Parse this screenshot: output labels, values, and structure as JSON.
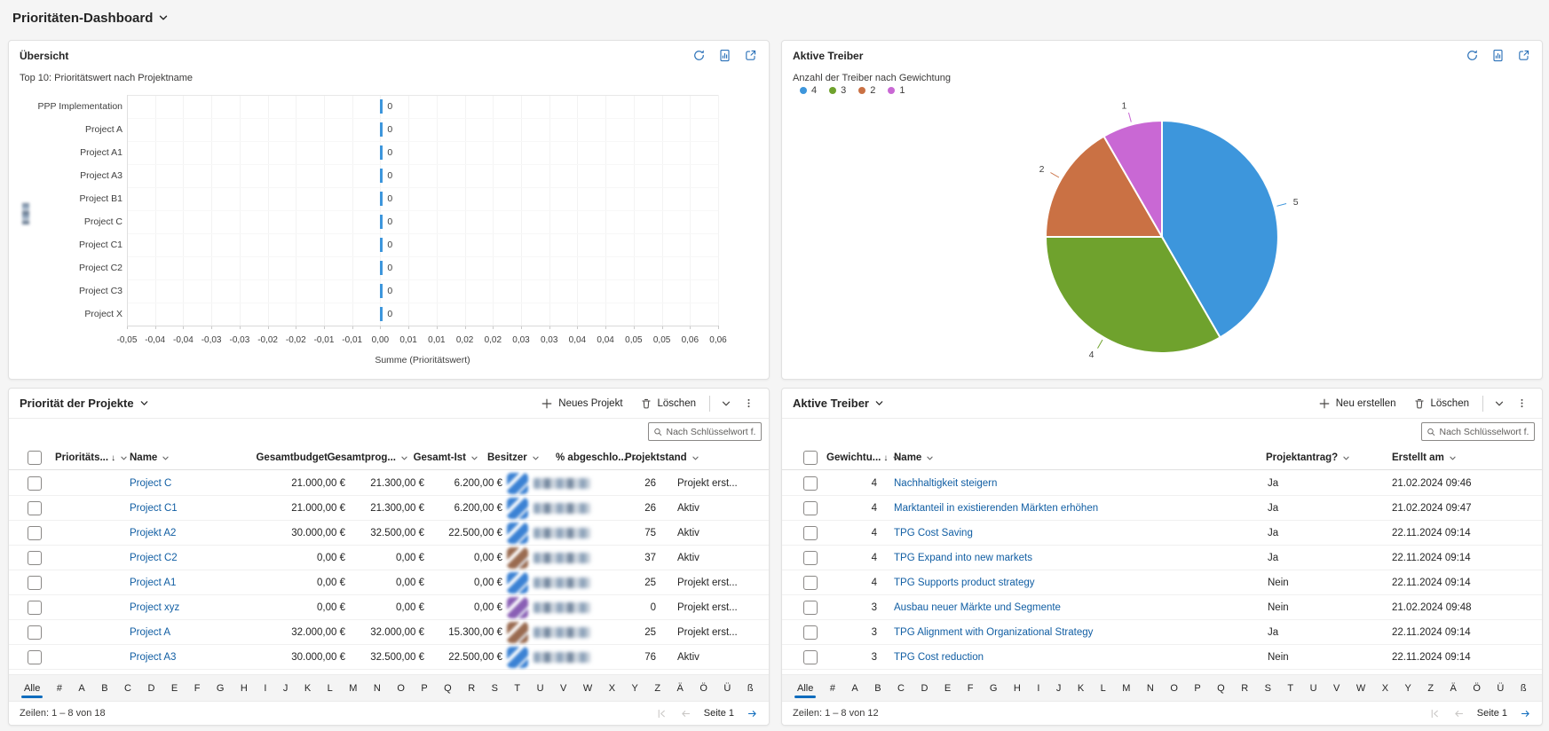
{
  "page": {
    "title": "Prioritäten-Dashboard"
  },
  "colors": {
    "accent": "#0F6CBD",
    "link": "#115EA3",
    "command_icon": "#484644",
    "chart_icon_blue": "#2B71B8",
    "bar_tick_blue": "#3D96DC",
    "pie_blue": "#3D96DC",
    "pie_green": "#6FA22D",
    "pie_orange": "#CA7144",
    "pie_magenta": "#C968D4",
    "pager_disabled": "#c8c6c4"
  },
  "overview_card": {
    "title": "Übersicht",
    "icons": [
      "refresh-icon",
      "report-icon",
      "popout-icon"
    ]
  },
  "drivers_chart_card": {
    "title": "Aktive Treiber",
    "icons": [
      "refresh-icon",
      "report-icon",
      "popout-icon"
    ]
  },
  "chart_data": [
    {
      "type": "bar",
      "orientation": "horizontal",
      "title": "Top 10: Prioritätswert nach Projektname",
      "categories": [
        "PPP Implementation",
        "Project A",
        "Project A1",
        "Project A3",
        "Project B1",
        "Project C",
        "Project C1",
        "Project C2",
        "Project C3",
        "Project X"
      ],
      "values": [
        0,
        0,
        0,
        0,
        0,
        0,
        0,
        0,
        0,
        0
      ],
      "value_labels": [
        "0",
        "0",
        "0",
        "0",
        "0",
        "0",
        "0",
        "0",
        "0",
        "0"
      ],
      "xlabel": "Summe (Prioritätswert)",
      "ylabel_blurred": true,
      "x_tick_labels": [
        "-0,05",
        "-0,04",
        "-0,04",
        "-0,03",
        "-0,03",
        "-0,02",
        "-0,02",
        "-0,01",
        "-0,01",
        "0,00",
        "0,01",
        "0,01",
        "0,02",
        "0,02",
        "0,03",
        "0,03",
        "0,04",
        "0,04",
        "0,05",
        "0,05",
        "0,06",
        "0,06"
      ],
      "zero_tick_index": 9,
      "bar_color": "#3D96DC",
      "grid": true
    },
    {
      "type": "pie",
      "title": "Anzahl der Treiber nach Gewichtung",
      "categories": [
        "4",
        "3",
        "2",
        "1"
      ],
      "values": [
        5,
        4,
        2,
        1
      ],
      "slice_labels": [
        "5",
        "4",
        "2",
        "1"
      ],
      "colors": [
        "#3D96DC",
        "#6FA22D",
        "#CA7144",
        "#C968D4"
      ],
      "legend_position": "top-left",
      "direction": "clockwise",
      "start_angle_deg": 0
    }
  ],
  "left_panel": {
    "title": "Priorität der Projekte",
    "toolbar": {
      "new_label": "Neues Projekt",
      "delete_label": "Löschen"
    },
    "search_placeholder": "Nach Schlüsselwort f...",
    "sort_indicator": "↓",
    "columns": [
      "Prioritäts...",
      "Name",
      "Gesamtbudget",
      "Gesamtprog...",
      "Gesamt-Ist",
      "Besitzer",
      "% abgeschlo...",
      "Projektstand"
    ],
    "rows": [
      {
        "name": "Project C",
        "budget": "21.000,00 €",
        "prog": "21.300,00 €",
        "ist": "6.200,00 €",
        "avatar_color": "#3b82d4",
        "pct": "26",
        "stand": "Projekt erst..."
      },
      {
        "name": "Project C1",
        "budget": "21.000,00 €",
        "prog": "21.300,00 €",
        "ist": "6.200,00 €",
        "avatar_color": "#3b82d4",
        "pct": "26",
        "stand": "Aktiv"
      },
      {
        "name": "Projekt A2",
        "budget": "30.000,00 €",
        "prog": "32.500,00 €",
        "ist": "22.500,00 €",
        "avatar_color": "#3b82d4",
        "pct": "75",
        "stand": "Aktiv"
      },
      {
        "name": "Project C2",
        "budget": "0,00 €",
        "prog": "0,00 €",
        "ist": "0,00 €",
        "avatar_color": "#9a6b50",
        "pct": "37",
        "stand": "Aktiv"
      },
      {
        "name": "Project A1",
        "budget": "0,00 €",
        "prog": "0,00 €",
        "ist": "0,00 €",
        "avatar_color": "#3b82d4",
        "pct": "25",
        "stand": "Projekt erst..."
      },
      {
        "name": "Project xyz",
        "budget": "0,00 €",
        "prog": "0,00 €",
        "ist": "0,00 €",
        "avatar_color": "#8a5fb5",
        "pct": "0",
        "stand": "Projekt erst..."
      },
      {
        "name": "Project A",
        "budget": "32.000,00 €",
        "prog": "32.000,00 €",
        "ist": "15.300,00 €",
        "avatar_color": "#9a6b50",
        "pct": "25",
        "stand": "Projekt erst..."
      },
      {
        "name": "Project A3",
        "budget": "30.000,00 €",
        "prog": "32.500,00 €",
        "ist": "22.500,00 €",
        "avatar_color": "#3b82d4",
        "pct": "76",
        "stand": "Aktiv"
      }
    ],
    "jumpbar": [
      "Alle",
      "#",
      "A",
      "B",
      "C",
      "D",
      "E",
      "F",
      "G",
      "H",
      "I",
      "J",
      "K",
      "L",
      "M",
      "N",
      "O",
      "P",
      "Q",
      "R",
      "S",
      "T",
      "U",
      "V",
      "W",
      "X",
      "Y",
      "Z",
      "Ä",
      "Ö",
      "Ü",
      "ß"
    ],
    "footer": {
      "rows_text": "Zeilen: 1 – 8 von 18",
      "page_text": "Seite 1"
    }
  },
  "right_panel": {
    "title": "Aktive Treiber",
    "toolbar": {
      "new_label": "Neu erstellen",
      "delete_label": "Löschen"
    },
    "search_placeholder": "Nach Schlüsselwort f...",
    "sort_indicator": "↓",
    "columns": [
      "Gewichtu...",
      "Name",
      "Projektantrag?",
      "Erstellt am"
    ],
    "rows": [
      {
        "weight": "4",
        "name": "Nachhaltigkeit steigern",
        "antrag": "Ja",
        "created": "21.02.2024 09:46"
      },
      {
        "weight": "4",
        "name": "Marktanteil in existierenden Märkten erhöhen",
        "antrag": "Ja",
        "created": "21.02.2024 09:47"
      },
      {
        "weight": "4",
        "name": "TPG Cost Saving",
        "antrag": "Ja",
        "created": "22.11.2024 09:14"
      },
      {
        "weight": "4",
        "name": "TPG Expand into new markets",
        "antrag": "Ja",
        "created": "22.11.2024 09:14"
      },
      {
        "weight": "4",
        "name": "TPG Supports product strategy",
        "antrag": "Nein",
        "created": "22.11.2024 09:14"
      },
      {
        "weight": "3",
        "name": "Ausbau neuer Märkte und Segmente",
        "antrag": "Nein",
        "created": "21.02.2024 09:48"
      },
      {
        "weight": "3",
        "name": "TPG Alignment with Organizational Strategy",
        "antrag": "Ja",
        "created": "22.11.2024 09:14"
      },
      {
        "weight": "3",
        "name": "TPG Cost reduction",
        "antrag": "Nein",
        "created": "22.11.2024 09:14"
      }
    ],
    "jumpbar": [
      "Alle",
      "#",
      "A",
      "B",
      "C",
      "D",
      "E",
      "F",
      "G",
      "H",
      "I",
      "J",
      "K",
      "L",
      "M",
      "N",
      "O",
      "P",
      "Q",
      "R",
      "S",
      "T",
      "U",
      "V",
      "W",
      "X",
      "Y",
      "Z",
      "Ä",
      "Ö",
      "Ü",
      "ß"
    ],
    "footer": {
      "rows_text": "Zeilen: 1 – 8 von 12",
      "page_text": "Seite 1"
    }
  }
}
